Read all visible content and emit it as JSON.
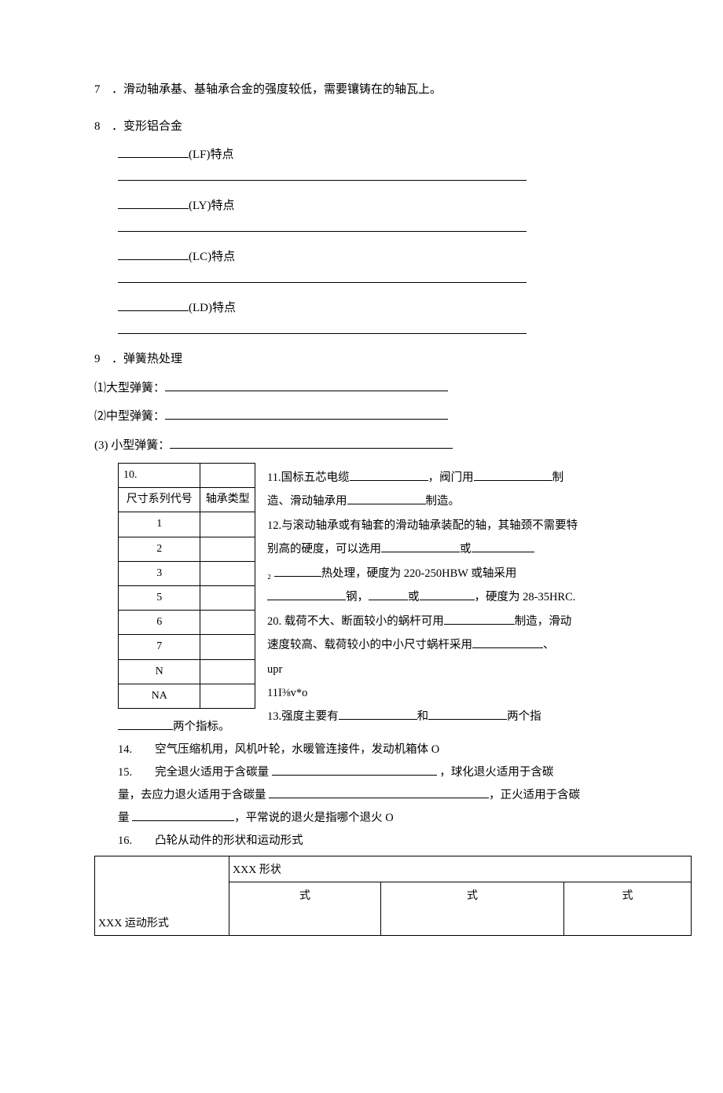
{
  "q7": {
    "num": "7",
    "text": "．滑动轴承基、基轴承合金的强度较低，需要镶铸在的轴瓦上。"
  },
  "q8": {
    "num": "8",
    "title": "．变形铝合金",
    "lines": [
      {
        "code": "(LF)特点"
      },
      {
        "code": "(LY)特点"
      },
      {
        "code": "(LC)特点"
      },
      {
        "code": "(LD)特点"
      }
    ]
  },
  "q9": {
    "num": "9",
    "title": "．弹簧热处理",
    "sub": [
      {
        "label": "⑴大型弹簧："
      },
      {
        "label": "⑵中型弹簧："
      },
      {
        "label": "(3) 小型弹簧："
      }
    ]
  },
  "q10": {
    "header_left": "10.",
    "col1_label": "尺寸系列代号",
    "col2_label": "轴承类型",
    "rows": [
      "1",
      "2",
      "3",
      "5",
      "6",
      "7",
      "N",
      "NA"
    ],
    "right_lines": {
      "l11a": "11.国标五芯电缆",
      "l11b": "，阀门用",
      "l11c": "制",
      "l11d": "造、滑动轴承用",
      "l11e": "制造。",
      "l12a": "12.与滚动轴承或有轴套的滑动轴承装配的轴，其轴颈不需要特",
      "l12b": "别高的硬度，可以选用",
      "l12c": "或",
      "l12d": "热处理，硬度为 220-250HBW 或轴采用",
      "l12e": "钢，",
      "l12f": "或",
      "l12g": "，硬度为 28-35HRC.",
      "l20a": "20. 载荷不大、断面较小的蜗杆可用",
      "l20b": "制造，滑动",
      "l20c": "速度较高、载荷较小的中小尺寸蜗杆采用",
      "l20d": "、",
      "upr": "upr",
      "ratio": "11I⅜v*o",
      "l13a": "13.强度主要有",
      "l13b": "和",
      "l13c": "两个指",
      "sub2": "₂"
    }
  },
  "after": {
    "two_label": "两个指标。",
    "q14": "14.　　空气压缩机用，风机叶轮，水暖管连接件，发动机箱体 O",
    "q15a": "15.　　完全退火适用于含碳量",
    "q15b": "，球化退火适用于含碳",
    "q15c": "量，去应力退火适用于含碳量",
    "q15d": "，正火适用于含碳",
    "q15e": "量",
    "q15f": "，平常说的退火是指哪个退火 O",
    "q16_title": "16.　　凸轮从动件的形状和运动形式",
    "q16_shape_label": "XXX 形状",
    "q16_motion_label": "XXX 运动形式",
    "q16_cell": "式"
  }
}
